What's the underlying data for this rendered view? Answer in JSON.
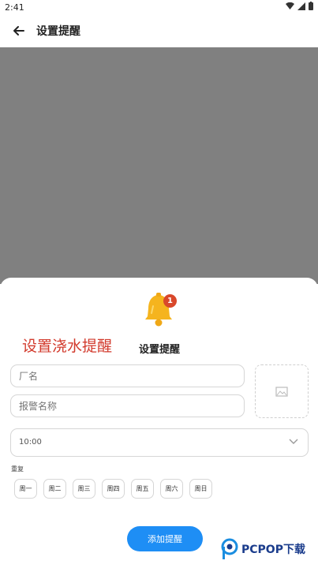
{
  "status_bar": {
    "time": "2:41"
  },
  "app_bar": {
    "title": "设置提醒"
  },
  "sheet": {
    "promo_label": "设置浇水提醒",
    "title": "设置提醒",
    "bell_badge": "1",
    "inputs": [
      {
        "name": "factory-name-input",
        "placeholder": "厂名"
      },
      {
        "name": "alarm-name-input",
        "placeholder": "报警名称"
      }
    ],
    "time_select": {
      "value": "10:00"
    },
    "repeat_label": "重复",
    "days": [
      "周一",
      "周二",
      "周三",
      "周四",
      "周五",
      "周六",
      "周日"
    ],
    "add_button": "添加提醒"
  },
  "watermark": {
    "brand": "PCPOP下载"
  },
  "colors": {
    "accent": "#1e8ef5",
    "promo_red": "#d23a2c",
    "overlay": "#808080",
    "bell": "#f5b41e",
    "badge": "#d9482b"
  }
}
